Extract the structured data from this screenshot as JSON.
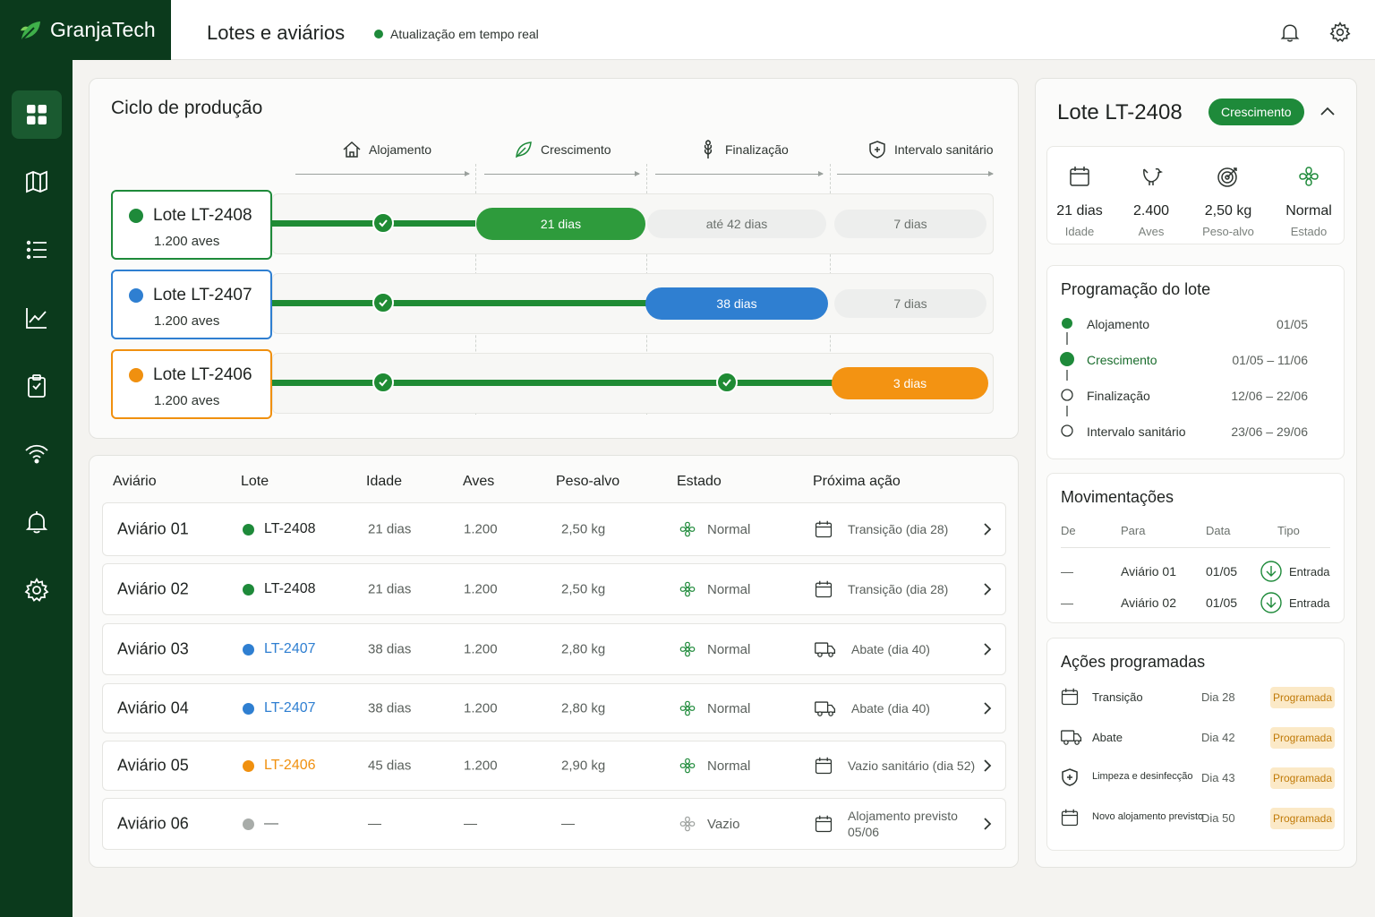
{
  "app": {
    "name": "GranjaTech"
  },
  "header": {
    "title": "Lotes e aviários",
    "live_status": "Atualização em tempo real"
  },
  "sidebar": {
    "items": [
      {
        "icon": "grid-icon",
        "active": true
      },
      {
        "icon": "map-icon"
      },
      {
        "icon": "list-icon"
      },
      {
        "icon": "chart-icon"
      },
      {
        "icon": "clipboard-icon"
      },
      {
        "icon": "wifi-icon"
      },
      {
        "icon": "bell-icon"
      },
      {
        "icon": "gear-icon"
      }
    ]
  },
  "cycle": {
    "title": "Ciclo de produção",
    "stages": [
      "Alojamento",
      "Crescimento",
      "Finalização",
      "Intervalo sanitário"
    ],
    "lots": [
      {
        "name": "Lote LT-2408",
        "birds": "1.200 aves",
        "color": "#1e8a3a",
        "active_label": "21 dias",
        "next_label": "até 42 dias",
        "last_label": "7 dias"
      },
      {
        "name": "Lote LT-2407",
        "birds": "1.200 aves",
        "color": "#2f7fd1",
        "active_label": "38 dias",
        "last_label": "7 dias"
      },
      {
        "name": "Lote LT-2406",
        "birds": "1.200 aves",
        "color": "#f0900f",
        "active_label": "3 dias"
      }
    ]
  },
  "table": {
    "headers": [
      "Aviário",
      "Lote",
      "Idade",
      "Aves",
      "Peso-alvo",
      "Estado",
      "Próxima ação"
    ],
    "rows": [
      {
        "aviario": "Aviário 01",
        "lote": "LT-2408",
        "lote_color": "#1e8a3a",
        "idade": "21 dias",
        "aves": "1.200",
        "peso": "2,50 kg",
        "estado": "Normal",
        "acao": "Transição (dia 28)",
        "acao_icon": "calendar-icon"
      },
      {
        "aviario": "Aviário 02",
        "lote": "LT-2408",
        "lote_color": "#1e8a3a",
        "idade": "21 dias",
        "aves": "1.200",
        "peso": "2,50 kg",
        "estado": "Normal",
        "acao": "Transição (dia 28)",
        "acao_icon": "calendar-icon"
      },
      {
        "aviario": "Aviário 03",
        "lote": "LT-2407",
        "lote_color": "#2f7fd1",
        "idade": "38 dias",
        "aves": "1.200",
        "peso": "2,80 kg",
        "estado": "Normal",
        "acao": "Abate (dia 40)",
        "acao_icon": "truck-icon"
      },
      {
        "aviario": "Aviário 04",
        "lote": "LT-2407",
        "lote_color": "#2f7fd1",
        "idade": "38 dias",
        "aves": "1.200",
        "peso": "2,80 kg",
        "estado": "Normal",
        "acao": "Abate (dia 40)",
        "acao_icon": "truck-icon"
      },
      {
        "aviario": "Aviário 05",
        "lote": "LT-2406",
        "lote_color": "#f0900f",
        "idade": "45 dias",
        "aves": "1.200",
        "peso": "2,90 kg",
        "estado": "Normal",
        "acao": "Vazio sanitário (dia 52)",
        "acao_icon": "calendar-icon"
      },
      {
        "aviario": "Aviário 06",
        "lote": "—",
        "lote_color": "#a8aca9",
        "idade": "—",
        "aves": "—",
        "peso": "—",
        "estado": "Vazio",
        "acao": "Alojamento previsto",
        "acao2": "05/06",
        "acao_icon": "calendar-icon"
      }
    ]
  },
  "detail": {
    "title": "Lote LT-2408",
    "badge": "Crescimento",
    "kpis": [
      {
        "value": "21 dias",
        "label": "Idade",
        "icon": "calendar-icon"
      },
      {
        "value": "2.400",
        "label": "Aves",
        "icon": "bird-icon"
      },
      {
        "value": "2,50 kg",
        "label": "Peso-alvo",
        "icon": "target-icon"
      },
      {
        "value": "Normal",
        "label": "Estado",
        "icon": "fan-icon"
      }
    ],
    "schedule": {
      "title": "Programação do lote",
      "items": [
        {
          "name": "Alojamento",
          "date": "01/05"
        },
        {
          "name": "Crescimento",
          "date": "01/05 – 11/06"
        },
        {
          "name": "Finalização",
          "date": "12/06 – 22/06"
        },
        {
          "name": "Intervalo sanitário",
          "date": "23/06 – 29/06"
        }
      ]
    },
    "movements": {
      "title": "Movimentações",
      "headers": [
        "De",
        "Para",
        "Data",
        "Tipo"
      ],
      "rows": [
        {
          "de": "—",
          "para": "Aviário 01",
          "data": "01/05",
          "tipo": "Entrada"
        },
        {
          "de": "—",
          "para": "Aviário 02",
          "data": "01/05",
          "tipo": "Entrada"
        }
      ]
    },
    "actions": {
      "title": "Ações programadas",
      "items": [
        {
          "name": "Transição",
          "day": "Dia 28",
          "status": "Programada",
          "icon": "calendar-icon"
        },
        {
          "name": "Abate",
          "day": "Dia 42",
          "status": "Programada",
          "icon": "truck-icon"
        },
        {
          "name": "Limpeza e desinfecção",
          "day": "Dia 43",
          "status": "Programada",
          "icon": "shield-icon"
        },
        {
          "name": "Novo alojamento previsto",
          "day": "Dia 50",
          "status": "Programada",
          "icon": "calendar-icon"
        }
      ]
    }
  }
}
